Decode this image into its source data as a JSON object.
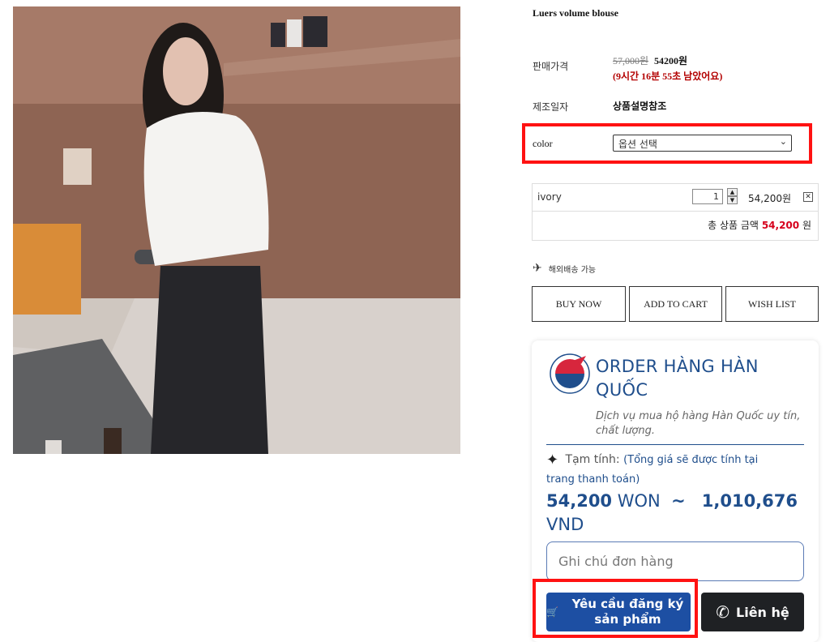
{
  "product": {
    "title": "Luers volume blouse",
    "price_label": "판매가격",
    "old_price": "57,000원",
    "new_price": "54200원",
    "countdown": "(9시간 16분 55초 남았어요)",
    "date_label": "제조일자",
    "date_value": "상품설명참조",
    "color_label": "color",
    "color_select_value": "옵션 선택"
  },
  "option": {
    "name": "ivory",
    "quantity": "1",
    "price": "54,200원",
    "total_label": "총 상품 금액",
    "total_amount": "54,200",
    "total_unit": "원"
  },
  "shipping": {
    "label": "해외배송 가능"
  },
  "actions": {
    "buy_now": "BUY NOW",
    "add_to_cart": "ADD TO CART",
    "wish_list": "WISH LIST"
  },
  "order_card": {
    "heading": "ORDER HÀNG HÀN QUỐC",
    "subtitle": "Dịch vụ mua hộ hàng Hàn Quốc uy tín, chất lượng.",
    "estimate_label": "Tạm tính:",
    "estimate_note_1": "(Tổng giá sẽ được tính tại",
    "estimate_note_2": "trang thanh toán)",
    "won_amount": "54,200",
    "won_unit": "WON",
    "tilde": "~",
    "vnd_amount": "1,010,676",
    "vnd_unit": "VND",
    "note_placeholder": "Ghi chú đơn hàng",
    "request_button": "Yêu cầu đăng ký sản phẩm",
    "contact_button": "Liên hệ"
  },
  "colors": {
    "highlight": "#ff1212",
    "brand_blue": "#1f4e8c",
    "button_blue": "#1d4fa3",
    "countdown_red": "#b30000",
    "total_red": "#d6001c"
  }
}
